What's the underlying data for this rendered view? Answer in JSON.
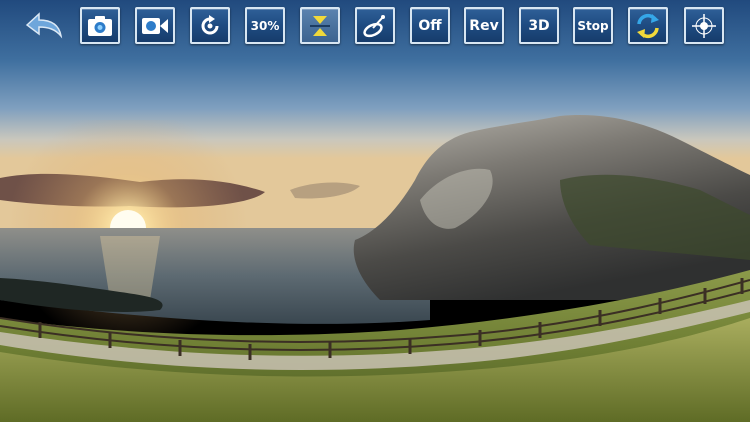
{
  "toolbar": {
    "back_icon": "back-arrow-icon",
    "buttons": [
      {
        "id": "snapshot",
        "icon": "camera-icon"
      },
      {
        "id": "record",
        "icon": "video-camera-icon"
      },
      {
        "id": "rotate",
        "icon": "rotate-icon"
      },
      {
        "id": "zoom",
        "label": "30%"
      },
      {
        "id": "flip",
        "icon": "vertical-flip-icon"
      },
      {
        "id": "projection",
        "icon": "dish-icon"
      },
      {
        "id": "mode",
        "label": "Off"
      },
      {
        "id": "reverse",
        "label": "Rev"
      },
      {
        "id": "view3d",
        "label": "3D"
      },
      {
        "id": "stop",
        "label": "Stop"
      },
      {
        "id": "refresh",
        "icon": "refresh-icon"
      },
      {
        "id": "center",
        "icon": "crosshair-icon"
      }
    ]
  },
  "colors": {
    "button_fill": "#1f4c82",
    "button_border": "#d8e6f2",
    "icon_accent": "#35a7e8",
    "icon_yellow": "#f1d93a"
  }
}
